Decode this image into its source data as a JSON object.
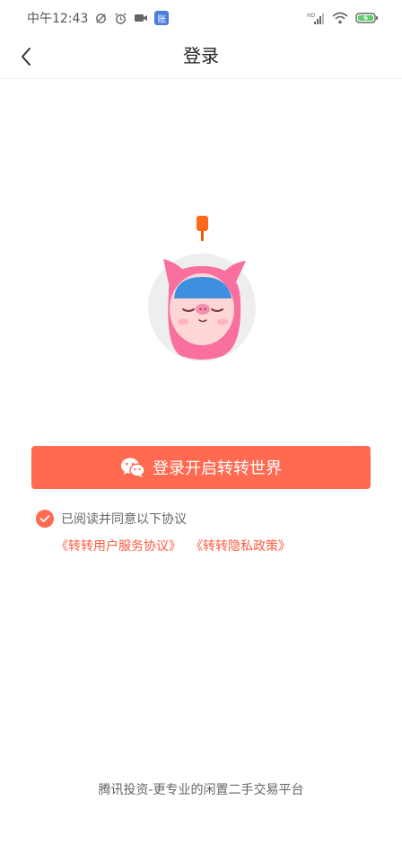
{
  "status_bar": {
    "time": "中午12:43",
    "app_badge": "账",
    "network_label": "HD"
  },
  "nav": {
    "title": "登录"
  },
  "login": {
    "button_label": "登录开启转转世界"
  },
  "agreement": {
    "text": "已阅读并同意以下协议",
    "user_agreement_link": "《转转用户服务协议》",
    "privacy_link": "《转转隐私政策》"
  },
  "footer": {
    "text": "腾讯投资-更专业的闲置二手交易平台"
  },
  "colors": {
    "accent": "#ff6a51",
    "link": "#ff5a3d"
  },
  "icons": {
    "back": "back-arrow-icon",
    "wechat": "wechat-icon",
    "check": "check-icon"
  }
}
